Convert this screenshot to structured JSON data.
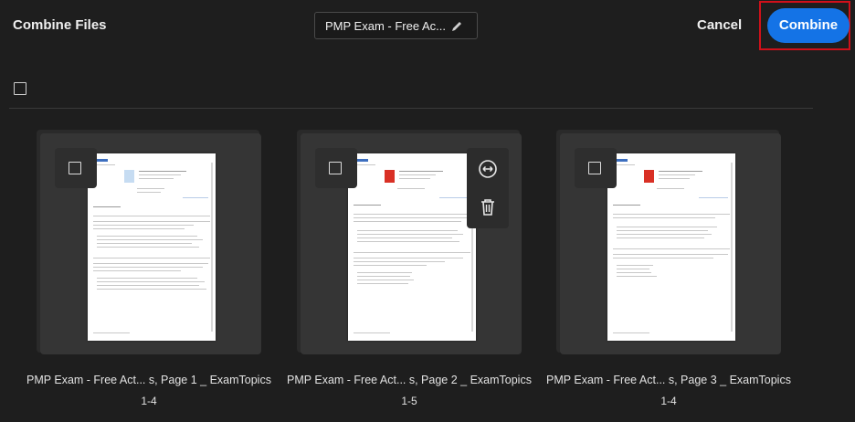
{
  "header": {
    "title": "Combine Files",
    "filename": "PMP Exam - Free Ac...",
    "cancel_label": "Cancel",
    "combine_label": "Combine"
  },
  "files": [
    {
      "name": "PMP Exam - Free Act... s, Page 1 _ ExamTopics",
      "range": "1-4",
      "icon": "doc-icon"
    },
    {
      "name": "PMP Exam - Free Act... s, Page 2 _ ExamTopics",
      "range": "1-5",
      "icon": "pdf-icon"
    },
    {
      "name": "PMP Exam - Free Act... s, Page 3 _ ExamTopics",
      "range": "1-4",
      "icon": "pdf-icon"
    }
  ],
  "card_actions": [
    "expand-pages-icon",
    "trash-icon"
  ],
  "colors": {
    "accent": "#1473e6",
    "highlight": "#d0101a",
    "background": "#1e1e1e"
  }
}
